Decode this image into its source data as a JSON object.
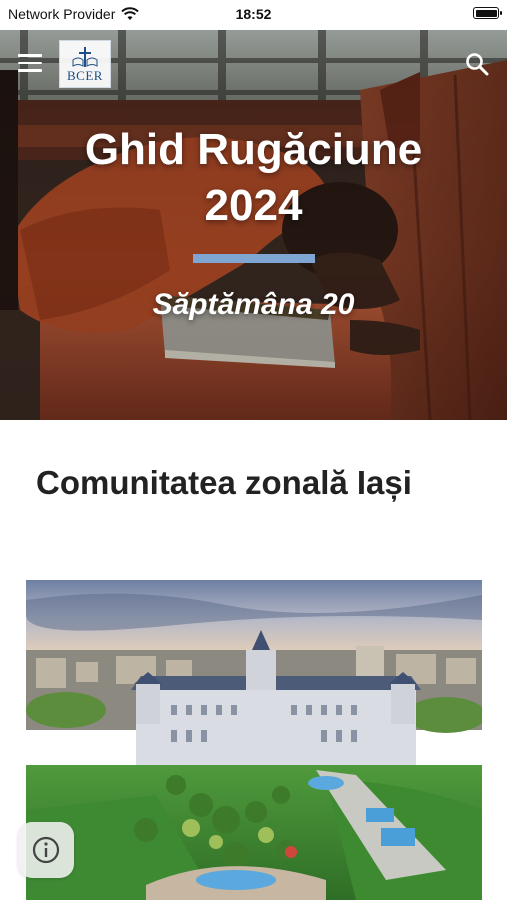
{
  "status_bar": {
    "carrier": "Network Provider",
    "time": "18:52"
  },
  "header": {
    "logo_text": "BCER",
    "menu_icon": "hamburger-menu-icon",
    "search_icon": "search-icon"
  },
  "hero": {
    "title_line1": "Ghid Rugăciune",
    "title_line2": "2024",
    "subtitle": "Săptămâna 20"
  },
  "content": {
    "section_title": "Comunitatea zonală Iași"
  },
  "floating": {
    "info_icon": "info-icon"
  }
}
